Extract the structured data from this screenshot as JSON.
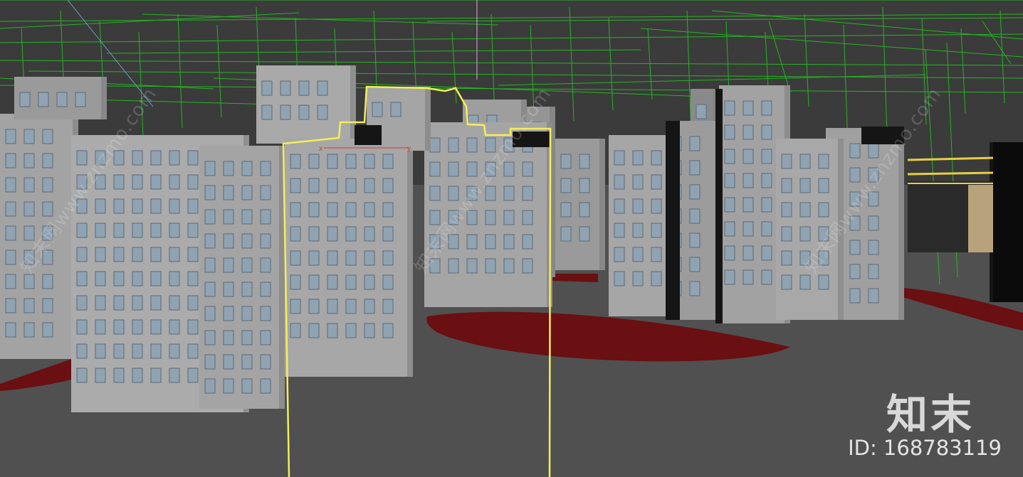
{
  "viewport": {
    "name": "3d-perspective-viewport",
    "background_color": "#505050",
    "sky_color": "#3b3b3b",
    "building_color": "#a8a8a8",
    "window_color": "#8fa3b3",
    "wireframe_color": "#22c31f",
    "selection_color": "#f4ee5a",
    "ground_patch_color": "#6a0f12"
  },
  "gizmo": {
    "x_label": "x",
    "y_label": "y"
  },
  "watermark": {
    "logo": "知末",
    "id_text": "ID: 168783119",
    "diagonal_text": "知末网www.znzmo.com"
  }
}
